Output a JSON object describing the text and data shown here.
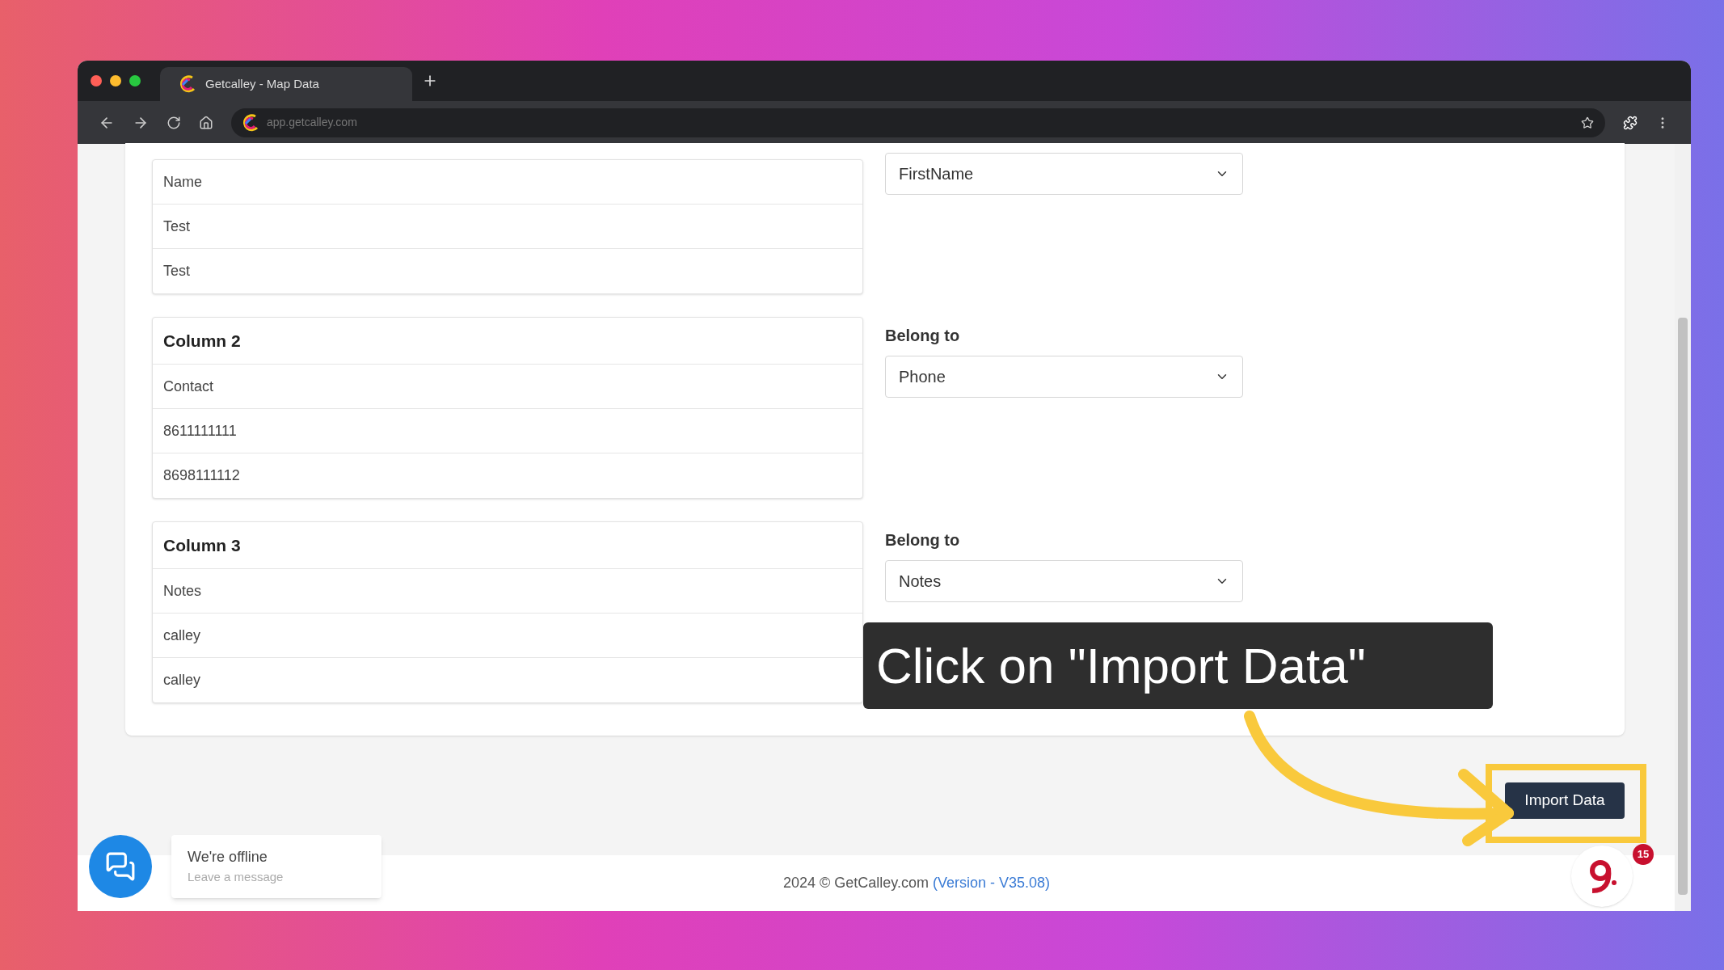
{
  "browser": {
    "tab_title": "Getcalley - Map Data",
    "url": "app.getcalley.com"
  },
  "groups": [
    {
      "rows": [
        "Name",
        "Test",
        "Test"
      ],
      "select_value": "FirstName"
    },
    {
      "title": "Column 2",
      "rows": [
        "Contact",
        "8611111111",
        "8698111112"
      ],
      "belong_label": "Belong to",
      "select_value": "Phone"
    },
    {
      "title": "Column 3",
      "rows": [
        "Notes",
        "calley",
        "calley"
      ],
      "belong_label": "Belong to",
      "select_value": "Notes"
    }
  ],
  "callout": "Click on \"Import Data\"",
  "import_button": "Import Data",
  "widget_badge": "15",
  "chat": {
    "title": "We're offline",
    "subtitle": "Leave a message"
  },
  "footer": {
    "text": "2024 © GetCalley.com",
    "link": "(Version - V35.08)"
  }
}
